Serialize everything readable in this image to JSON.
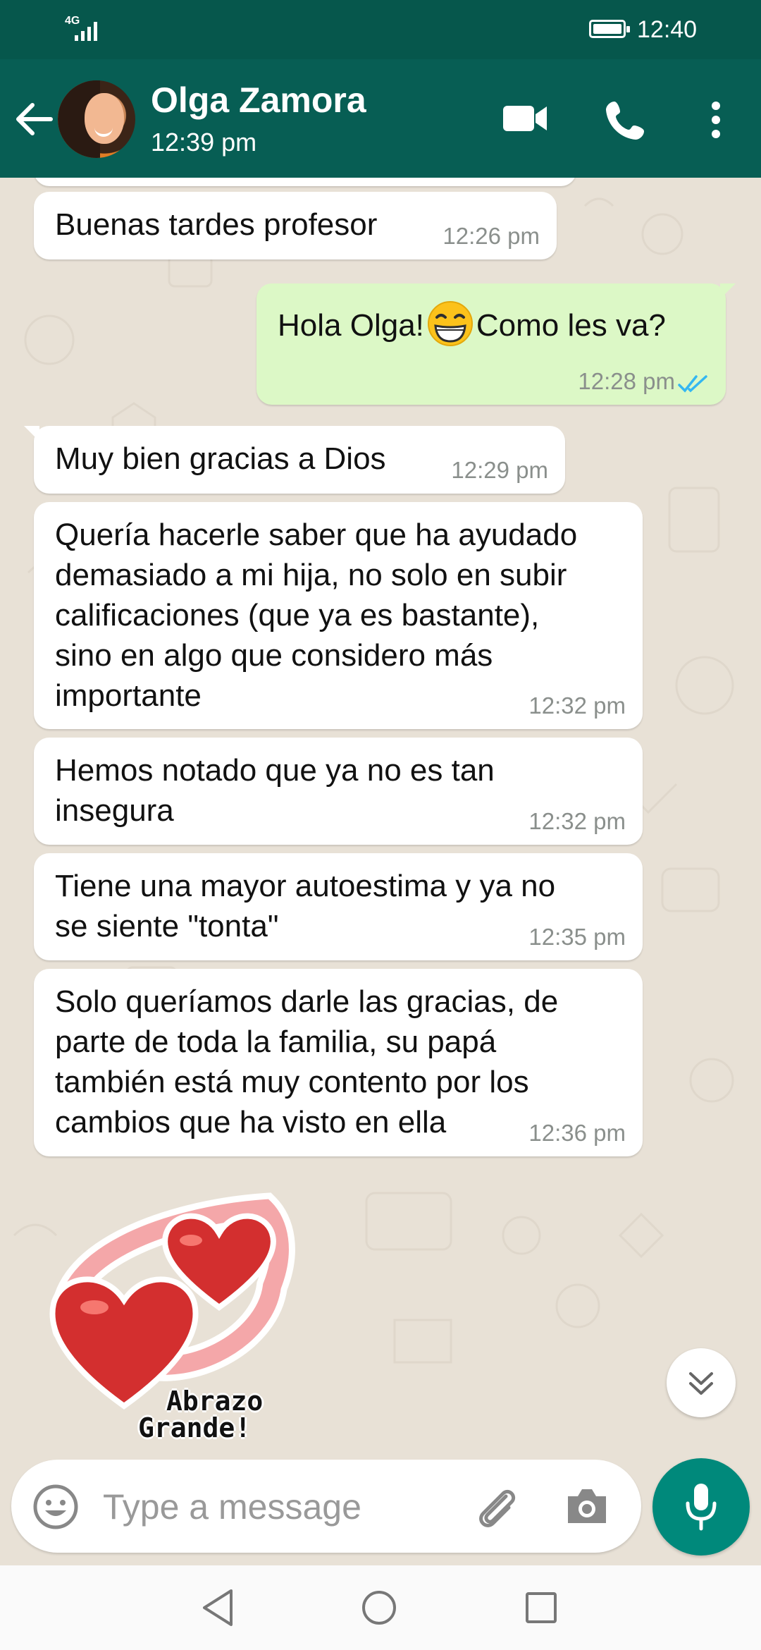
{
  "status_bar": {
    "network": "4G",
    "time": "12:40"
  },
  "header": {
    "contact_name": "Olga Zamora",
    "last_seen": "12:39 pm"
  },
  "messages": [
    {
      "direction": "in",
      "text": "Buenas tardes profesor",
      "time": "12:26 pm"
    },
    {
      "direction": "out",
      "text_before": "Hola Olga!",
      "emoji": "grinning-face",
      "text_after": "Como les va?",
      "time": "12:28 pm",
      "status": "read"
    },
    {
      "direction": "in",
      "text": "Muy bien gracias a Dios",
      "time": "12:29 pm"
    },
    {
      "direction": "in",
      "lines": [
        "Quería hacerle saber que ha ayudado",
        "demasiado a mi hija, no solo en subir",
        "calificaciones (que ya es bastante),",
        "sino en algo que considero más",
        "importante"
      ],
      "time": "12:32 pm"
    },
    {
      "direction": "in",
      "lines": [
        "Hemos notado que ya no es tan",
        "insegura"
      ],
      "time": "12:32 pm"
    },
    {
      "direction": "in",
      "lines": [
        "Tiene una mayor autoestima y ya no",
        "se siente \"tonta\""
      ],
      "time": "12:35 pm"
    },
    {
      "direction": "in",
      "lines": [
        "Solo queríamos darle las gracias, de",
        "parte de toda la familia, su papá",
        "también está muy contento por los",
        "cambios que ha visto en ella"
      ],
      "time": "12:36 pm"
    }
  ],
  "sticker": {
    "lines": [
      "Abrazo",
      "Grande!"
    ],
    "colors": {
      "heart": "#d32f2f",
      "ribbon": "#f4a7a9"
    }
  },
  "composer": {
    "placeholder": "Type a message"
  },
  "colors": {
    "header": "#075e54",
    "status_bar": "#06574c",
    "incoming": "#ffffff",
    "outgoing": "#dcf8c6",
    "read_ticks": "#34b7f1",
    "fab": "#00897b"
  }
}
